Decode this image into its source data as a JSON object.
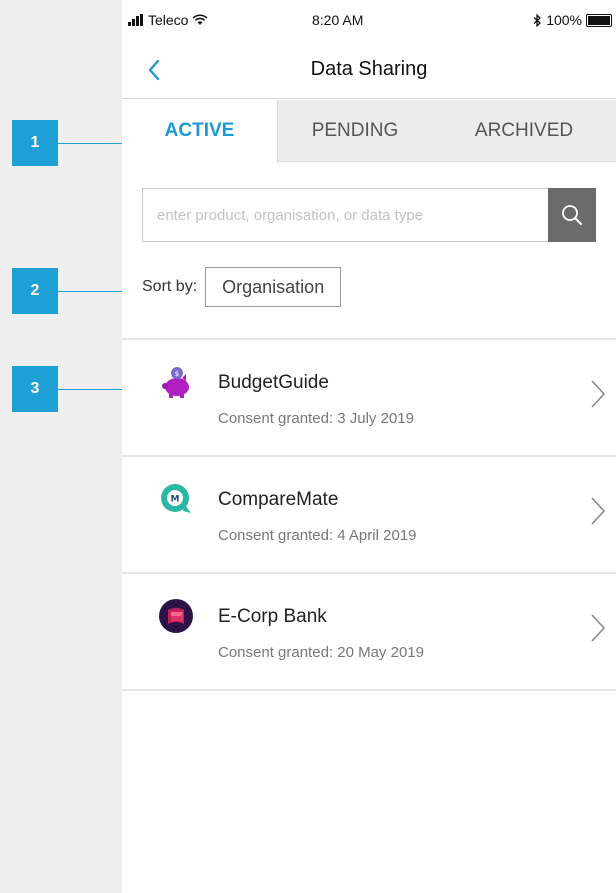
{
  "status_bar": {
    "carrier": "Teleco",
    "time": "8:20 AM",
    "battery": "100%",
    "icons": [
      "signal-icon",
      "wifi-icon",
      "bluetooth-icon",
      "battery-icon"
    ]
  },
  "nav": {
    "title": "Data Sharing",
    "back_icon": "chevron-left-icon"
  },
  "tabs": [
    {
      "label": "ACTIVE",
      "active": true
    },
    {
      "label": "PENDING",
      "active": false
    },
    {
      "label": "ARCHIVED",
      "active": false
    }
  ],
  "search": {
    "placeholder": "enter product, organisation, or data type",
    "value": "",
    "icon": "search-icon"
  },
  "sort": {
    "label": "Sort by:",
    "value": "Organisation"
  },
  "items": [
    {
      "name": "BudgetGuide",
      "consent": "Consent granted: 3 July 2019",
      "icon": "piggy-bank-icon"
    },
    {
      "name": "CompareMate",
      "consent": "Consent granted: 4 April 2019",
      "icon": "comparemate-logo-icon"
    },
    {
      "name": "E-Corp Bank",
      "consent": "Consent granted: 20 May 2019",
      "icon": "ecorp-logo-icon"
    }
  ],
  "callouts": [
    "1",
    "2",
    "3"
  ],
  "colors": {
    "accent": "#1a9ad6",
    "callout": "#1fa0d4",
    "search_button": "#6b6b6b",
    "background": "#efefef"
  }
}
